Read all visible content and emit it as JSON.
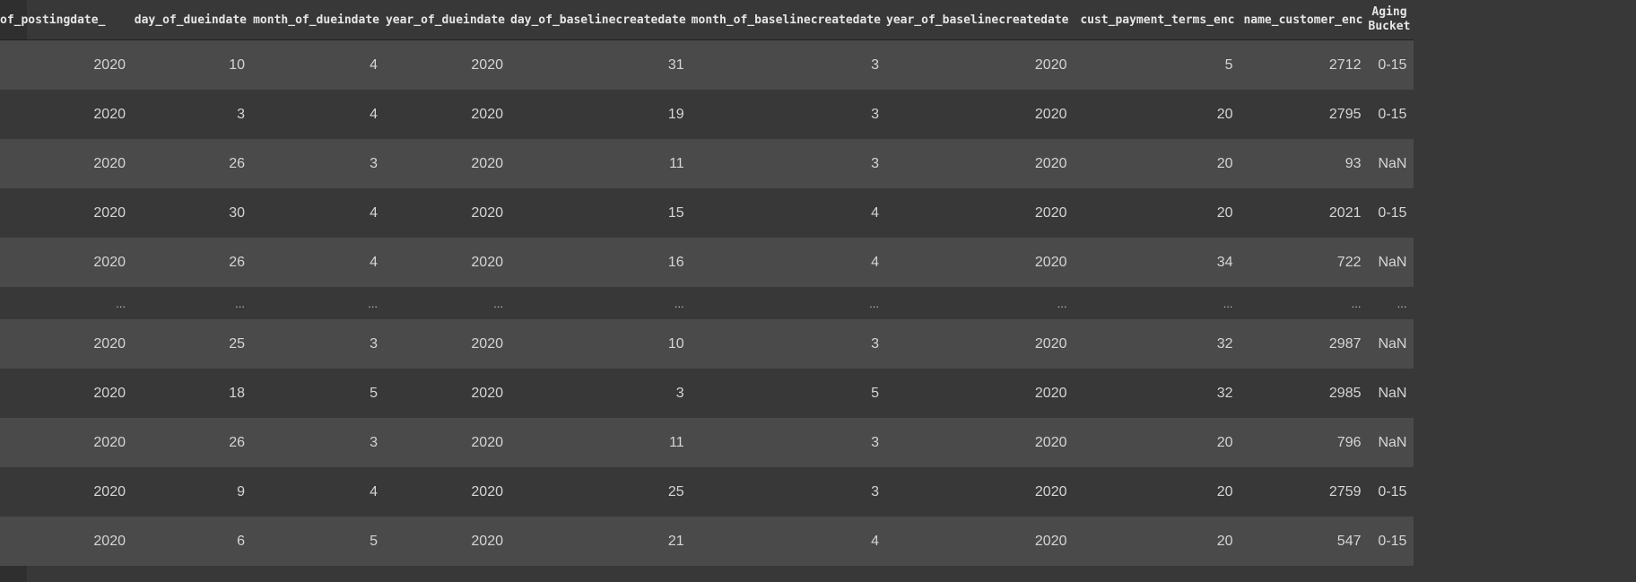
{
  "columns": [
    "_of_postingdate",
    "day_of_dueindate",
    "month_of_dueindate",
    "year_of_dueindate",
    "day_of_baselinecreatedate",
    "month_of_baselinecreatedate",
    "year_of_baselinecreatedate",
    "cust_payment_terms_enc",
    "name_customer_enc",
    "Aging Bucket"
  ],
  "rows_top": [
    [
      "2020",
      "10",
      "4",
      "2020",
      "31",
      "3",
      "2020",
      "5",
      "2712",
      "0-15"
    ],
    [
      "2020",
      "3",
      "4",
      "2020",
      "19",
      "3",
      "2020",
      "20",
      "2795",
      "0-15"
    ],
    [
      "2020",
      "26",
      "3",
      "2020",
      "11",
      "3",
      "2020",
      "20",
      "93",
      "NaN"
    ],
    [
      "2020",
      "30",
      "4",
      "2020",
      "15",
      "4",
      "2020",
      "20",
      "2021",
      "0-15"
    ],
    [
      "2020",
      "26",
      "4",
      "2020",
      "16",
      "4",
      "2020",
      "34",
      "722",
      "NaN"
    ]
  ],
  "ellipsis": "...",
  "rows_bottom": [
    [
      "2020",
      "25",
      "3",
      "2020",
      "10",
      "3",
      "2020",
      "32",
      "2987",
      "NaN"
    ],
    [
      "2020",
      "18",
      "5",
      "2020",
      "3",
      "5",
      "2020",
      "32",
      "2985",
      "NaN"
    ],
    [
      "2020",
      "26",
      "3",
      "2020",
      "11",
      "3",
      "2020",
      "20",
      "796",
      "NaN"
    ],
    [
      "2020",
      "9",
      "4",
      "2020",
      "25",
      "3",
      "2020",
      "20",
      "2759",
      "0-15"
    ],
    [
      "2020",
      "6",
      "5",
      "2020",
      "21",
      "4",
      "2020",
      "20",
      "547",
      "0-15"
    ]
  ],
  "colors": {
    "background": "#383838",
    "row_stripe": "#4a4a4a",
    "text": "#d5d5d5",
    "header_text": "#e6e6e6"
  }
}
